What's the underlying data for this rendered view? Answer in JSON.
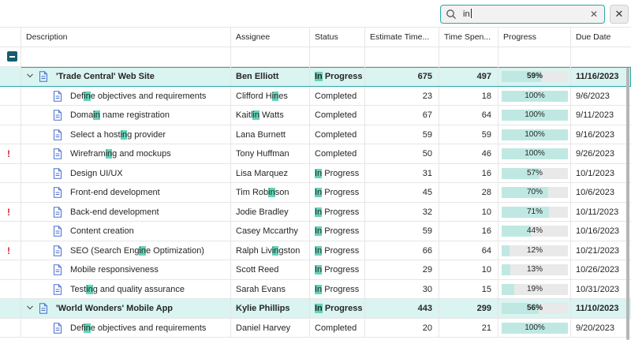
{
  "search": {
    "value": "in"
  },
  "columns": [
    {
      "label": "Description"
    },
    {
      "label": "Assignee"
    },
    {
      "label": "Status"
    },
    {
      "label": "Estimate Time..."
    },
    {
      "label": "Time Spen..."
    },
    {
      "label": "Progress"
    },
    {
      "label": "Due Date"
    }
  ],
  "rows": [
    {
      "type": "group",
      "desc": "'Trade Central' Web Site",
      "assignee": "Ben Elliott",
      "status": "In Progress",
      "estimate": "675",
      "spent": "497",
      "progress": "59%",
      "progress_value": 59,
      "due": "11/16/2023",
      "flag": false,
      "selected": true
    },
    {
      "type": "task",
      "desc": "Define objectives and requirements",
      "assignee": "Clifford Hines",
      "status": "Completed",
      "estimate": "23",
      "spent": "18",
      "progress": "100%",
      "progress_value": 100,
      "due": "9/6/2023",
      "flag": false
    },
    {
      "type": "task",
      "desc": "Domain name registration",
      "assignee": "Kaitlin Watts",
      "status": "Completed",
      "estimate": "67",
      "spent": "64",
      "progress": "100%",
      "progress_value": 100,
      "due": "9/11/2023",
      "flag": false
    },
    {
      "type": "task",
      "desc": "Select a hosting provider",
      "assignee": "Lana Burnett",
      "status": "Completed",
      "estimate": "59",
      "spent": "59",
      "progress": "100%",
      "progress_value": 100,
      "due": "9/16/2023",
      "flag": false
    },
    {
      "type": "task",
      "desc": "Wireframing and mockups",
      "assignee": "Tony Huffman",
      "status": "Completed",
      "estimate": "50",
      "spent": "46",
      "progress": "100%",
      "progress_value": 100,
      "due": "9/26/2023",
      "flag": true
    },
    {
      "type": "task",
      "desc": "Design UI/UX",
      "assignee": "Lisa Marquez",
      "status": "In Progress",
      "estimate": "31",
      "spent": "16",
      "progress": "57%",
      "progress_value": 57,
      "due": "10/1/2023",
      "flag": false
    },
    {
      "type": "task",
      "desc": "Front-end development",
      "assignee": "Tim Robinson",
      "status": "In Progress",
      "estimate": "45",
      "spent": "28",
      "progress": "70%",
      "progress_value": 70,
      "due": "10/6/2023",
      "flag": false
    },
    {
      "type": "task",
      "desc": "Back-end development",
      "assignee": "Jodie Bradley",
      "status": "In Progress",
      "estimate": "32",
      "spent": "10",
      "progress": "71%",
      "progress_value": 71,
      "due": "10/11/2023",
      "flag": true
    },
    {
      "type": "task",
      "desc": "Content creation",
      "assignee": "Casey Mccarthy",
      "status": "In Progress",
      "estimate": "59",
      "spent": "16",
      "progress": "44%",
      "progress_value": 44,
      "due": "10/16/2023",
      "flag": false
    },
    {
      "type": "task",
      "desc": "SEO (Search Engine Optimization)",
      "assignee": "Ralph Livingston",
      "status": "In Progress",
      "estimate": "66",
      "spent": "64",
      "progress": "12%",
      "progress_value": 12,
      "due": "10/21/2023",
      "flag": true
    },
    {
      "type": "task",
      "desc": "Mobile responsiveness",
      "assignee": "Scott Reed",
      "status": "In Progress",
      "estimate": "29",
      "spent": "10",
      "progress": "13%",
      "progress_value": 13,
      "due": "10/26/2023",
      "flag": false
    },
    {
      "type": "task",
      "desc": "Testing and quality assurance",
      "assignee": "Sarah Evans",
      "status": "In Progress",
      "estimate": "30",
      "spent": "15",
      "progress": "19%",
      "progress_value": 19,
      "due": "10/31/2023",
      "flag": false
    },
    {
      "type": "group",
      "desc": "'World Wonders' Mobile App",
      "assignee": "Kylie Phillips",
      "status": "In Progress",
      "estimate": "443",
      "spent": "299",
      "progress": "56%",
      "progress_value": 56,
      "due": "11/10/2023",
      "flag": false,
      "selected": false
    },
    {
      "type": "task",
      "desc": "Define objectives and requirements",
      "assignee": "Daniel Harvey",
      "status": "Completed",
      "estimate": "20",
      "spent": "21",
      "progress": "100%",
      "progress_value": 100,
      "due": "9/20/2023",
      "flag": false
    }
  ]
}
